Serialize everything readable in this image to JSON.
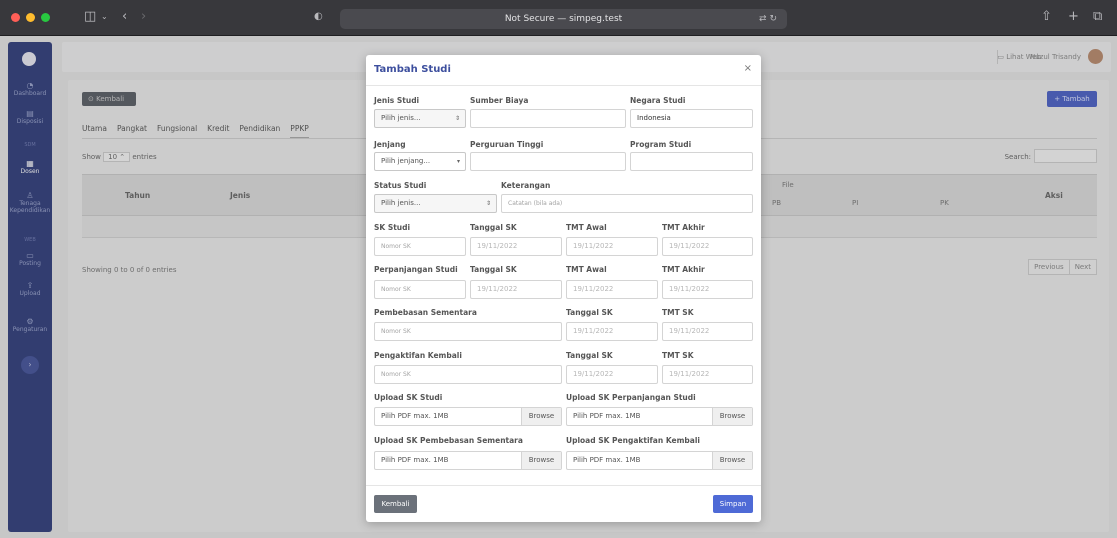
{
  "browser": {
    "url_text": "Not Secure — simpeg.test"
  },
  "sidebar": {
    "items": [
      {
        "label": "Dashboard"
      },
      {
        "label": "Disposisi"
      },
      {
        "label": "Dosen"
      },
      {
        "label": "Tenaga Kependidikan"
      },
      {
        "label": "Posting"
      },
      {
        "label": "Upload"
      },
      {
        "label": "Pengaturan"
      }
    ],
    "headings": [
      "SDM",
      "WEB"
    ]
  },
  "topbar": {
    "lihat_web": "Lihat Web",
    "user_name": "Nuzul Trisandy"
  },
  "background": {
    "back_label": "Kembali",
    "add_label": "Tambah",
    "tabs": [
      "Utama",
      "Pangkat",
      "Fungsional",
      "Kredit",
      "Pendidikan",
      "PPKP"
    ],
    "show_prefix": "Show",
    "show_value": "10",
    "show_suffix": "entries",
    "search_label": "Search:",
    "columns": {
      "tahun": "Tahun",
      "jenis": "Jenis",
      "file": "File",
      "pb": "PB",
      "pi": "PI",
      "pk": "PK",
      "aksi": "Aksi"
    },
    "showing_text": "Showing 0 to 0 of 0 entries",
    "previous": "Previous",
    "next": "Next"
  },
  "modal": {
    "title": "Tambah Studi",
    "close": "×",
    "jenis_studi": {
      "label": "Jenis Studi",
      "value": "Pilih jenis..."
    },
    "sumber_biaya": {
      "label": "Sumber Biaya",
      "value": ""
    },
    "negara_studi": {
      "label": "Negara Studi",
      "value": "Indonesia"
    },
    "jenjang": {
      "label": "Jenjang",
      "value": "Pilih jenjang..."
    },
    "perguruan_tinggi": {
      "label": "Perguruan Tinggi",
      "value": ""
    },
    "program_studi": {
      "label": "Program Studi",
      "value": ""
    },
    "status_studi": {
      "label": "Status Studi",
      "value": "Pilih jenis..."
    },
    "keterangan": {
      "label": "Keterangan",
      "placeholder": "Catatan (bila ada)"
    },
    "sk_studi": {
      "label": "SK Studi",
      "placeholder": "Nomor SK"
    },
    "tanggal_sk_label": "Tanggal SK",
    "tmt_awal_label": "TMT Awal",
    "tmt_akhir_label": "TMT Akhir",
    "tmt_sk_label": "TMT SK",
    "date_value": "19/11/2022",
    "perpanjangan": {
      "label": "Perpanjangan Studi",
      "placeholder": "Nomor SK"
    },
    "pembebasan": {
      "label": "Pembebasan Sementara",
      "placeholder": "Nomor SK"
    },
    "pengaktifan": {
      "label": "Pengaktifan Kembali",
      "placeholder": "Nomor SK"
    },
    "uploads": {
      "sk_studi": "Upload SK Studi",
      "sk_perpanjangan": "Upload SK Perpanjangan Studi",
      "sk_pembebasan": "Upload SK Pembebasan Sementara",
      "sk_pengaktifan": "Upload SK Pengaktifan Kembali",
      "file_placeholder": "Pilih PDF max. 1MB",
      "browse": "Browse"
    },
    "kembali": "Kembali",
    "simpan": "Simpan"
  },
  "colors": {
    "primary": "#4e6ad6",
    "sidebar": "#303e7c",
    "title": "#3d4f9e",
    "secondary": "#6b717a"
  }
}
